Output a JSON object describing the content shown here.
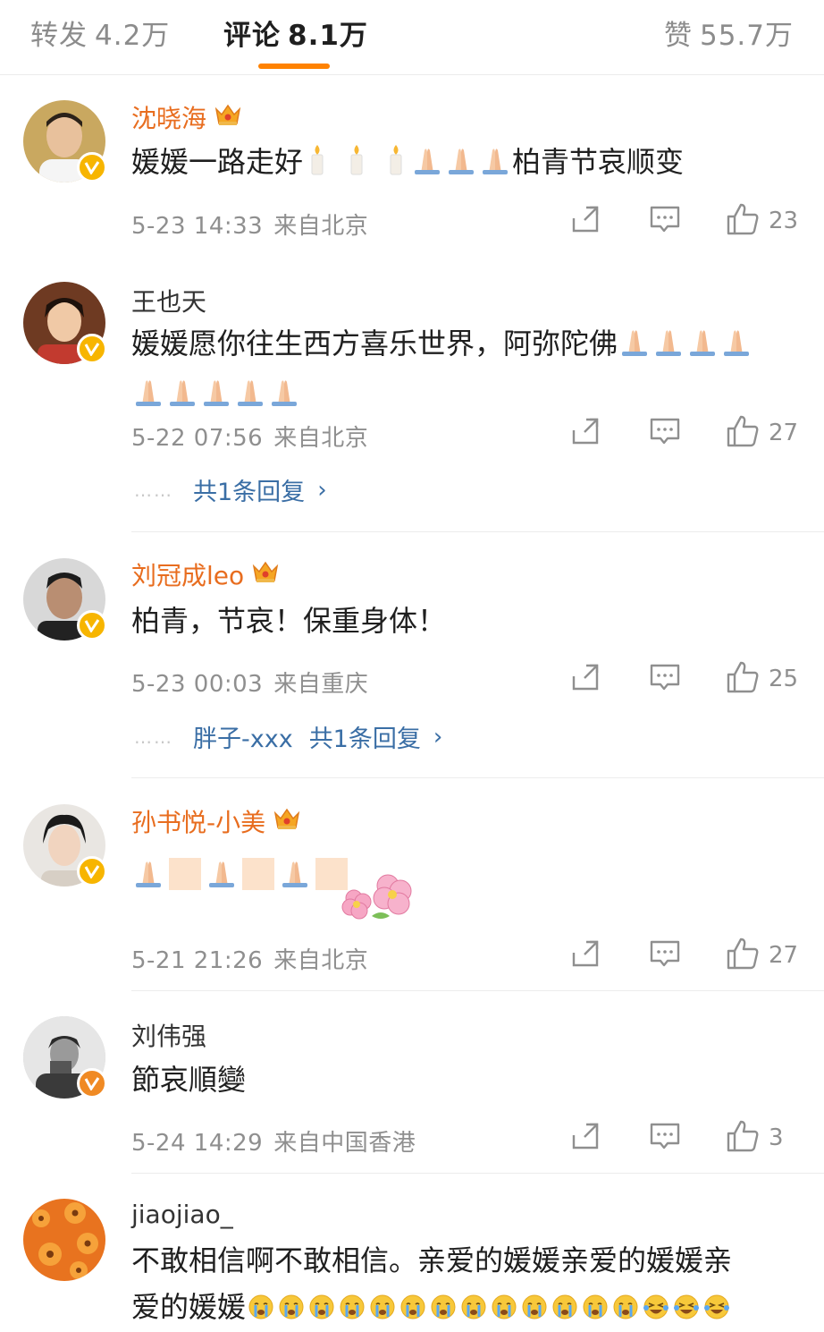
{
  "tabs": {
    "repost": {
      "label": "转发",
      "count": "4.2万"
    },
    "comment": {
      "label": "评论",
      "count": "8.1万"
    },
    "like": {
      "label": "赞",
      "count": "55.7万"
    }
  },
  "colors": {
    "accent": "#ff8200",
    "vip_name": "#e86d1f",
    "link": "#3a6ea5",
    "verified_yellow": "#f7b500",
    "verified_orange": "#f08a24"
  },
  "comments": [
    {
      "name": "沈晓海",
      "vip": true,
      "text_before": "媛媛一路走好",
      "text_after": "柏青节哀顺变",
      "emojis": [
        "candle",
        "candle",
        "candle",
        "pray",
        "pray",
        "pray"
      ],
      "time": "5-23 14:33",
      "location": "来自北京",
      "likes": "23"
    },
    {
      "name": "王也天",
      "vip": false,
      "text_before": "媛媛愿你往生西方喜乐世界，阿弥陀佛",
      "emojis": [
        "pray",
        "pray",
        "pray",
        "pray",
        "pray",
        "pray",
        "pray",
        "pray",
        "pray"
      ],
      "time": "5-22 07:56",
      "location": "来自北京",
      "likes": "27",
      "replies": {
        "dots": "……",
        "label": "共1条回复"
      }
    },
    {
      "name": "刘冠成leo",
      "vip": true,
      "text": "柏青，节哀！保重身体！",
      "time": "5-23 00:03",
      "location": "来自重庆",
      "likes": "25",
      "replies": {
        "dots": "……",
        "user": "胖子-xxx",
        "label": "共1条回复"
      }
    },
    {
      "name": "孙书悦-小美",
      "vip": true,
      "emojis": [
        "pray",
        "tile",
        "pray",
        "tile",
        "pray",
        "tile"
      ],
      "sticker": "flowers",
      "time": "5-21 21:26",
      "location": "来自北京",
      "likes": "27"
    },
    {
      "name": "刘伟强",
      "vip": false,
      "text": "節哀順變",
      "time": "5-24 14:29",
      "location": "来自中国香港",
      "likes": "3"
    },
    {
      "name": "jiaojiao_",
      "vip": false,
      "text_line1": "不敢相信啊不敢相信。亲爱的媛媛亲爱的媛媛亲",
      "text_line2": "爱的媛媛",
      "emojis": [
        "cry",
        "cry",
        "cry",
        "cry",
        "cry",
        "cry",
        "cry",
        "cry",
        "cry",
        "cry",
        "cry",
        "cry",
        "cry",
        "laughcry",
        "laughcry",
        "laughcry"
      ]
    }
  ],
  "icons": {
    "share": "share-icon",
    "comment": "comment-icon",
    "like": "thumbs-up-icon",
    "crown": "crown-icon",
    "verified": "verified-badge-icon"
  }
}
